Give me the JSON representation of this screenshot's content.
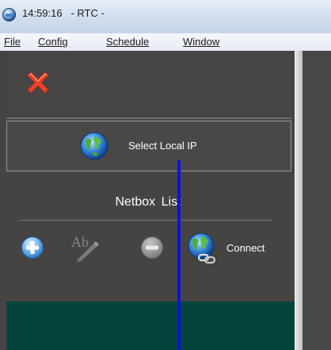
{
  "window": {
    "time": "14:59:16",
    "title": "- RTC -",
    "app_icon": "globe-app-icon"
  },
  "menu": {
    "items": [
      {
        "label": "File"
      },
      {
        "label": "Config"
      },
      {
        "label": "Schedule"
      },
      {
        "label": "Window"
      }
    ]
  },
  "panel": {
    "close_icon": "close-icon",
    "select_ip": {
      "label": "Select Local IP",
      "icon": "globe-icon"
    },
    "netbox_list_title": "Netbox List",
    "toolbar": {
      "add_icon": "add-icon",
      "rename_icon": "rename-icon",
      "remove_icon": "remove-icon",
      "connect": {
        "label": "Connect",
        "icon": "globe-link-icon"
      }
    }
  },
  "colors": {
    "panel_bg": "#464343",
    "green_area": "#02443c",
    "marker_line": "#0a12e8",
    "close_red": "#e8452c"
  }
}
